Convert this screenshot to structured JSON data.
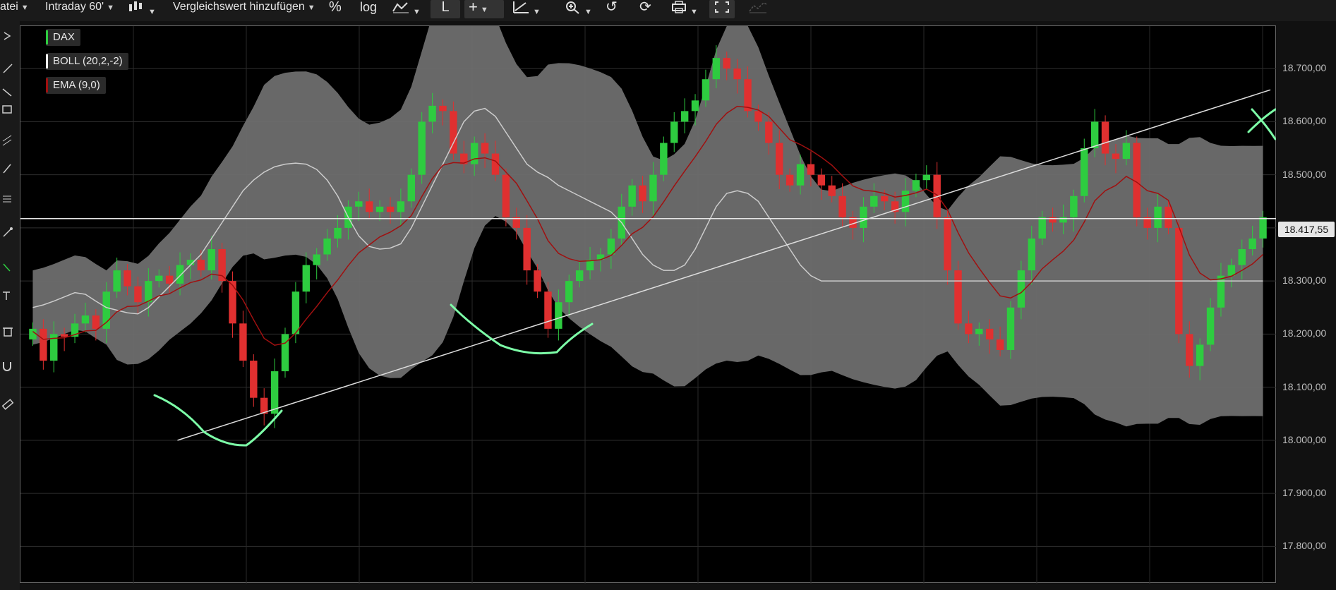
{
  "toolbar": {
    "file_label": "atei",
    "interval_label": "Intraday 60'",
    "compare_label": "Vergleichswert hinzufügen",
    "percent_label": "%",
    "log_label": "log",
    "draw_label": "L"
  },
  "legend": {
    "dax": "DAX",
    "boll": "BOLL (20,2,-2)",
    "ema": "EMA (9,0)"
  },
  "axis": {
    "ticks": [
      "18.700,00",
      "18.600,00",
      "18.500,00",
      "18.400,00",
      "18.300,00",
      "18.200,00",
      "18.100,00",
      "18.000,00",
      "17.900,00",
      "17.800,00"
    ],
    "current_price": "18.417,55"
  },
  "colors": {
    "up": "#2ecc40",
    "down": "#e03030",
    "ema": "#a01010",
    "boll_band": "#6e6e6e",
    "boll_mid": "#cccccc",
    "annotation": "#7dffa8"
  },
  "chart_data": {
    "type": "candlestick",
    "ylim": [
      17730,
      18780
    ],
    "y_ticks": [
      18700,
      18600,
      18500,
      18400,
      18300,
      18200,
      18100,
      18000,
      17900,
      17800
    ],
    "current_price": 18417.55,
    "close": [
      18210,
      18150,
      18200,
      18195,
      18220,
      18235,
      18210,
      18280,
      18320,
      18290,
      18260,
      18300,
      18310,
      18295,
      18330,
      18340,
      18320,
      18360,
      18300,
      18220,
      18150,
      18080,
      18050,
      18130,
      18200,
      18280,
      18330,
      18350,
      18380,
      18400,
      18440,
      18450,
      18430,
      18440,
      18430,
      18450,
      18500,
      18600,
      18630,
      18620,
      18540,
      18520,
      18560,
      18540,
      18500,
      18420,
      18400,
      18320,
      18280,
      18210,
      18260,
      18300,
      18320,
      18340,
      18350,
      18380,
      18440,
      18480,
      18450,
      18500,
      18560,
      18600,
      18620,
      18640,
      18680,
      18720,
      18700,
      18680,
      18620,
      18600,
      18560,
      18500,
      18480,
      18520,
      18500,
      18480,
      18460,
      18420,
      18400,
      18440,
      18460,
      18450,
      18430,
      18470,
      18490,
      18500,
      18420,
      18320,
      18220,
      18200,
      18210,
      18190,
      18170,
      18250,
      18320,
      18380,
      18420,
      18410,
      18420,
      18460,
      18550,
      18600,
      18540,
      18530,
      18560,
      18420,
      18400,
      18440,
      18400,
      18200,
      18140,
      18180,
      18250,
      18310,
      18330,
      18360,
      18380,
      18420
    ],
    "ema": [
      18205,
      18190,
      18192,
      18193,
      18199,
      18206,
      18207,
      18222,
      18242,
      18252,
      18253,
      18262,
      18272,
      18276,
      18287,
      18297,
      18302,
      18313,
      18310,
      18292,
      18264,
      18227,
      18192,
      18179,
      18183,
      18202,
      18228,
      18252,
      18278,
      18302,
      18329,
      18353,
      18368,
      18383,
      18392,
      18404,
      18423,
      18459,
      18493,
      18518,
      18523,
      18522,
      18530,
      18532,
      18526,
      18505,
      18484,
      18451,
      18417,
      18376,
      18352,
      18342,
      18337,
      18338,
      18340,
      18348,
      18367,
      18389,
      18401,
      18421,
      18449,
      18479,
      18507,
      18534,
      18563,
      18595,
      18616,
      18629,
      18627,
      18622,
      18610,
      18588,
      18566,
      18557,
      18546,
      18533,
      18518,
      18498,
      18479,
      18471,
      18469,
      18465,
      18458,
      18461,
      18466,
      18473,
      18462,
      18434,
      18391,
      18353,
      18324,
      18297,
      18272,
      18268,
      18278,
      18298,
      18323,
      18340,
      18356,
      18377,
      18411,
      18451,
      18470,
      18480,
      18497,
      18486,
      18470,
      18465,
      18452,
      18402,
      18349,
      18315,
      18302,
      18304,
      18309,
      18320,
      18332,
      18350
    ],
    "boll_mid": [
      18250,
      18255,
      18262,
      18270,
      18278,
      18275,
      18262,
      18250,
      18245,
      18240,
      18238,
      18250,
      18270,
      18290,
      18310,
      18330,
      18350,
      18380,
      18410,
      18440,
      18470,
      18490,
      18505,
      18515,
      18520,
      18522,
      18520,
      18510,
      18490,
      18460,
      18420,
      18385,
      18365,
      18360,
      18362,
      18370,
      18400,
      18440,
      18480,
      18520,
      18560,
      18600,
      18620,
      18625,
      18610,
      18580,
      18550,
      18520,
      18505,
      18495,
      18480,
      18470,
      18460,
      18450,
      18440,
      18430,
      18410,
      18380,
      18350,
      18330,
      18320,
      18320,
      18330,
      18360,
      18400,
      18440,
      18465,
      18470,
      18465,
      18450,
      18420,
      18390,
      18360,
      18330,
      18310,
      18300,
      18300,
      18300,
      18300,
      18300,
      18300,
      18300,
      18300,
      18300,
      18300,
      18300,
      18300,
      18300,
      18300,
      18300,
      18300,
      18300,
      18300,
      18300,
      18300,
      18300,
      18300,
      18300,
      18300,
      18300,
      18300,
      18300,
      18300,
      18300,
      18300,
      18300,
      18300,
      18300,
      18300,
      18300,
      18300,
      18300,
      18300,
      18300,
      18300,
      18300,
      18300,
      18300
    ],
    "annotations": {
      "trendline": [
        [
          0.125,
          18000
        ],
        [
          0.995,
          18660
        ]
      ],
      "horizontal_line": 18417.55
    }
  }
}
